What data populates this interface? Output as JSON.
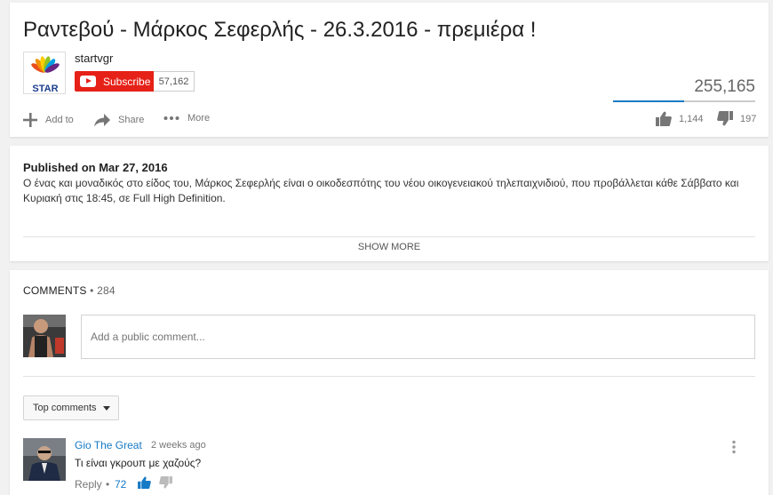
{
  "video": {
    "title": "Ραντεβού - Μάρκος Σεφερλής - 26.3.2016 - πρεμιέρα !",
    "views": "255,165",
    "views_ratio": 0.5,
    "likes": "1,144",
    "dislikes": "197"
  },
  "channel": {
    "name": "startvgr",
    "logo_text": "STAR",
    "subscribe_label": "Subscribe",
    "subscriber_count": "57,162"
  },
  "actions": {
    "add_to": "Add to",
    "share": "Share",
    "more": "More"
  },
  "description": {
    "published": "Published on Mar 27, 2016",
    "text": "Ο ένας και μοναδικός στο είδος του, Μάρκος Σεφερλής είναι ο οικοδεσπότης του νέου οικογενειακού τηλεπαιχνιδιού, που προβάλλεται κάθε Σάββατο και Κυριακή στις 18:45, σε Full High Definition.",
    "show_more": "SHOW MORE"
  },
  "comments": {
    "header": "COMMENTS",
    "separator": " • ",
    "count": "284",
    "placeholder": "Add a public comment...",
    "sort_label": "Top comments",
    "items": [
      {
        "author": "Gio The Great",
        "time": "2 weeks ago",
        "text": "Τι είναι γκρουπ με χαζούς?",
        "reply_label": "Reply",
        "dot": "•",
        "likes": "72"
      }
    ]
  },
  "colors": {
    "accent": "#167ac6",
    "subscribe_red": "#e62117"
  }
}
